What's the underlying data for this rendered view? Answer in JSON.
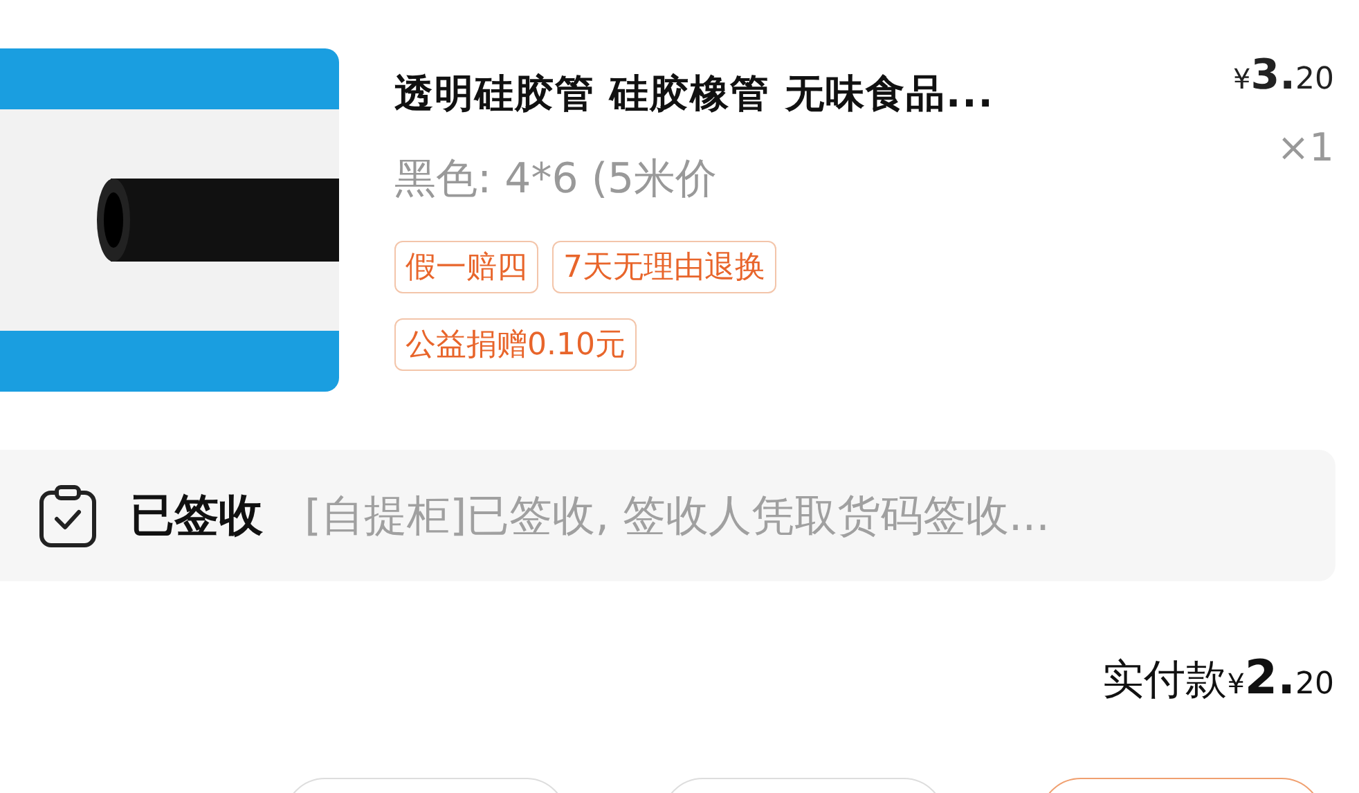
{
  "product": {
    "title": "透明硅胶管 硅胶橡管 无味食品...",
    "variant": "黑色: 4*6 (5米价",
    "price_symbol": "¥",
    "price_int": "3.",
    "price_dec": "20",
    "quantity": "×1",
    "tags": [
      {
        "label": "假一赔四"
      },
      {
        "label": "7天无理由退换"
      },
      {
        "label": "公益捐赠0.10元"
      }
    ]
  },
  "logistics": {
    "status": "已签收",
    "message": "[自提柜]已签收, 签收人凭取货码签收..."
  },
  "payment": {
    "label": "实付款",
    "symbol": "¥",
    "int": "2.",
    "dec": "20"
  },
  "buttons": [
    {
      "kind": "plain"
    },
    {
      "kind": "plain"
    },
    {
      "kind": "primary"
    }
  ]
}
